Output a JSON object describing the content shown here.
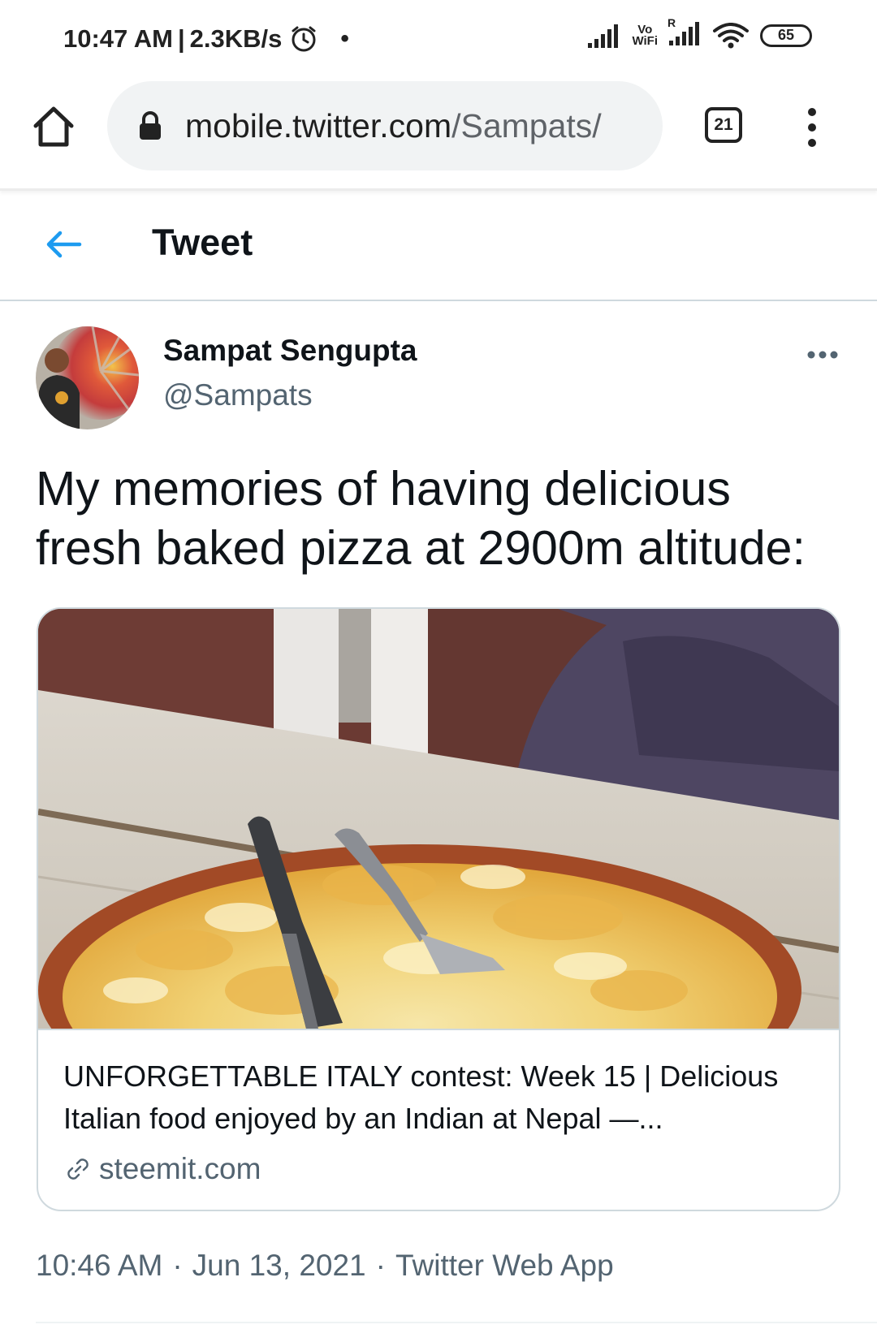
{
  "status_bar": {
    "time": "10:47 AM",
    "speed": "2.3KB/s",
    "separator": "|",
    "vowifi_top": "Vo",
    "vowifi_bottom": "WiFi",
    "roaming": "R",
    "battery": "65",
    "icons": [
      "alarm-icon",
      "signal-icon",
      "vowifi-icon",
      "signal-roaming-icon",
      "wifi-icon",
      "battery-icon"
    ]
  },
  "browser": {
    "url_domain": "mobile.twitter.com",
    "url_path": "/Sampats/",
    "tab_count": "21",
    "icons": [
      "home-icon",
      "lock-icon",
      "tabs-icon",
      "overflow-menu-icon"
    ]
  },
  "header": {
    "title": "Tweet",
    "back_icon": "back-arrow-icon",
    "accent": "#1d9bf0"
  },
  "tweet": {
    "author_name": "Sampat Sengupta",
    "author_handle": "@Sampats",
    "text": "My memories of having delicious fresh baked pizza at 2900m altitude:",
    "card": {
      "title": "UNFORGETTABLE ITALY contest: Week 15 | Delicious Italian food enjoyed by an Indian at Nepal —...",
      "domain": "steemit.com",
      "link_icon": "link-icon"
    },
    "time": "10:46 AM",
    "date": "Jun 13, 2021",
    "source": "Twitter Web App",
    "dot": "·"
  },
  "colors": {
    "text_primary": "#0f1419",
    "text_secondary": "#536471",
    "border": "#cfd9de",
    "url_bar_bg": "#f1f3f4"
  }
}
